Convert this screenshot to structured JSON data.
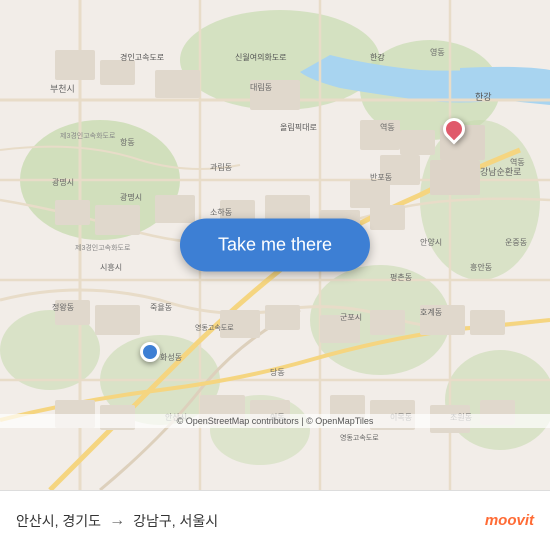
{
  "map": {
    "background_color": "#e8e0d8",
    "attribution": "© OpenStreetMap contributors | © OpenMapTiles"
  },
  "button": {
    "label": "Take me there"
  },
  "bottom_bar": {
    "origin": "안산시, 경기도",
    "arrow": "→",
    "destination": "강남구, 서울시"
  },
  "logo": {
    "brand": "moovit",
    "color": "#ff6b35"
  },
  "pins": {
    "origin_color": "#3d7fd4",
    "destination_color": "#e05a6b"
  }
}
